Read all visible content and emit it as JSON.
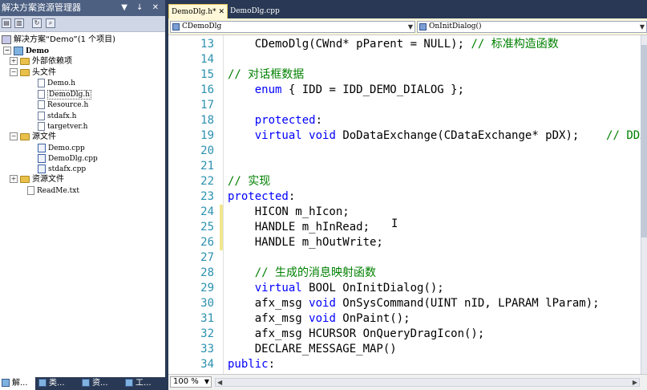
{
  "solution_explorer": {
    "title": "解决方案资源管理器",
    "title_buttons": "▼ ↓ ✕",
    "toolbar_icons": [
      "properties-icon",
      "show-all-files-icon",
      "refresh-icon",
      "view-code-icon"
    ],
    "tree": {
      "solution": "解决方案“Demo”(1 个项目)",
      "project": "Demo",
      "external_deps": "外部依赖项",
      "header_folder": "头文件",
      "header_files": [
        "Demo.h",
        "DemoDlg.h",
        "Resource.h",
        "stdafx.h",
        "targetver.h"
      ],
      "source_folder": "源文件",
      "source_files": [
        "Demo.cpp",
        "DemoDlg.cpp",
        "stdafx.cpp"
      ],
      "resource_folder": "资源文件",
      "readme": "ReadMe.txt"
    },
    "bottom_tabs": [
      "解...",
      "类...",
      "资...",
      "工..."
    ]
  },
  "editor": {
    "tabs": [
      {
        "label": "DemoDlg.h*",
        "active": true
      },
      {
        "label": "DemoDlg.cpp",
        "active": false
      }
    ],
    "tab_close": "✕",
    "class_combo": "CDemoDlg",
    "member_combo": "OnInitDialog()",
    "zoom": "100 %",
    "lines": [
      {
        "n": "13",
        "changed": false,
        "segs": [
          {
            "t": "    CDemoDlg(CWnd* pParent = NULL); ",
            "c": ""
          },
          {
            "t": "// 标准构造函数",
            "c": "cm"
          }
        ]
      },
      {
        "n": "14",
        "changed": false,
        "segs": []
      },
      {
        "n": "15",
        "changed": false,
        "segs": [
          {
            "t": "// 对话框数据",
            "c": "cm"
          }
        ]
      },
      {
        "n": "16",
        "changed": false,
        "segs": [
          {
            "t": "    ",
            "c": ""
          },
          {
            "t": "enum",
            "c": "kw"
          },
          {
            "t": " { IDD = IDD_DEMO_DIALOG };",
            "c": ""
          }
        ]
      },
      {
        "n": "17",
        "changed": false,
        "segs": []
      },
      {
        "n": "18",
        "changed": false,
        "segs": [
          {
            "t": "    ",
            "c": ""
          },
          {
            "t": "protected",
            "c": "kw"
          },
          {
            "t": ":",
            "c": ""
          }
        ]
      },
      {
        "n": "19",
        "changed": false,
        "segs": [
          {
            "t": "    ",
            "c": ""
          },
          {
            "t": "virtual",
            "c": "kw"
          },
          {
            "t": " ",
            "c": ""
          },
          {
            "t": "void",
            "c": "kw"
          },
          {
            "t": " DoDataExchange(CDataExchange* pDX);    ",
            "c": ""
          },
          {
            "t": "// DDX/",
            "c": "cm"
          }
        ]
      },
      {
        "n": "20",
        "changed": false,
        "segs": []
      },
      {
        "n": "21",
        "changed": false,
        "segs": []
      },
      {
        "n": "22",
        "changed": false,
        "segs": [
          {
            "t": "// 实现",
            "c": "cm"
          }
        ]
      },
      {
        "n": "23",
        "changed": false,
        "segs": [
          {
            "t": "protected",
            "c": "kw"
          },
          {
            "t": ":",
            "c": ""
          }
        ]
      },
      {
        "n": "24",
        "changed": true,
        "segs": [
          {
            "t": "    HICON m_hIcon;",
            "c": ""
          }
        ]
      },
      {
        "n": "25",
        "changed": true,
        "segs": [
          {
            "t": "    HANDLE m_hInRead;",
            "c": ""
          }
        ]
      },
      {
        "n": "26",
        "changed": true,
        "segs": [
          {
            "t": "    HANDLE m_hOutWrite;",
            "c": ""
          }
        ]
      },
      {
        "n": "27",
        "changed": false,
        "segs": []
      },
      {
        "n": "28",
        "changed": false,
        "segs": [
          {
            "t": "    ",
            "c": ""
          },
          {
            "t": "// 生成的消息映射函数",
            "c": "cm"
          }
        ]
      },
      {
        "n": "29",
        "changed": false,
        "segs": [
          {
            "t": "    ",
            "c": ""
          },
          {
            "t": "virtual",
            "c": "kw"
          },
          {
            "t": " BOOL OnInitDialog();",
            "c": ""
          }
        ]
      },
      {
        "n": "30",
        "changed": false,
        "segs": [
          {
            "t": "    afx_msg ",
            "c": ""
          },
          {
            "t": "void",
            "c": "kw"
          },
          {
            "t": " OnSysCommand(UINT nID, LPARAM lParam);",
            "c": ""
          }
        ]
      },
      {
        "n": "31",
        "changed": false,
        "segs": [
          {
            "t": "    afx_msg ",
            "c": ""
          },
          {
            "t": "void",
            "c": "kw"
          },
          {
            "t": " OnPaint();",
            "c": ""
          }
        ]
      },
      {
        "n": "32",
        "changed": false,
        "segs": [
          {
            "t": "    afx_msg HCURSOR OnQueryDragIcon();",
            "c": ""
          }
        ]
      },
      {
        "n": "33",
        "changed": false,
        "segs": [
          {
            "t": "    DECLARE_MESSAGE_MAP()",
            "c": ""
          }
        ]
      },
      {
        "n": "34",
        "changed": false,
        "segs": [
          {
            "t": "public",
            "c": "kw"
          },
          {
            "t": ":",
            "c": ""
          }
        ]
      }
    ]
  },
  "colors": {
    "keyword": "#0000ff",
    "comment": "#008000",
    "line_number": "#2b91af",
    "frame": "#293955",
    "active_tab": "#fff8d8"
  }
}
